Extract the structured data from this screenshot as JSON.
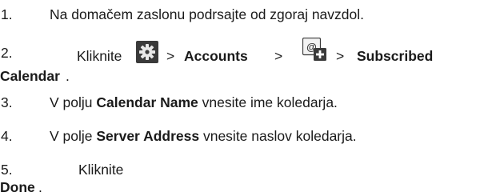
{
  "steps": [
    {
      "number": "1.",
      "text": "Na domačem zaslonu podrsajte od zgoraj navzdol."
    },
    {
      "number": "2.",
      "pre": "Kliknite",
      "sep1": ">",
      "accounts": "Accounts",
      "sep2": ">",
      "sep3": ">",
      "subscribed": "Subscribed",
      "calendar": "Calendar",
      "period": ".",
      "icon1": "settings-gear-icon",
      "icon2": "add-account-icon"
    },
    {
      "number": "3.",
      "pre": "V polju ",
      "bold": "Calendar Name",
      "post": " vnesite ime koledarja."
    },
    {
      "number": "4.",
      "pre": "V polje ",
      "bold": "Server Address",
      "post": " vnesite naslov koledarja."
    },
    {
      "number": "5.",
      "pre": "Kliknite",
      "done": "Done",
      "period": "."
    }
  ],
  "colors": {
    "text": "#1a1a1a",
    "icon_background": "#3a3a3a",
    "icon_foreground": "#e8e8e8"
  }
}
